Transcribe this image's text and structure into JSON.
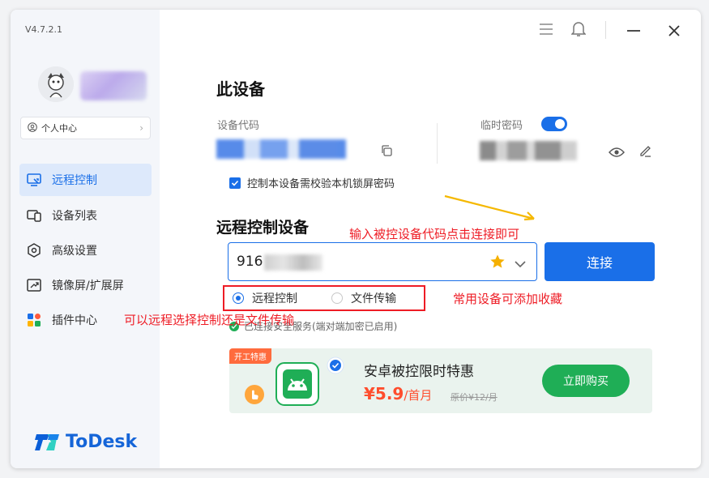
{
  "app": {
    "version": "V4.7.2.1",
    "logo_text": "ToDesk"
  },
  "sidebar": {
    "profile_button": "个人中心",
    "items": [
      {
        "label": "远程控制",
        "icon": "remote-control-icon",
        "active": true
      },
      {
        "label": "设备列表",
        "icon": "device-list-icon",
        "active": false
      },
      {
        "label": "高级设置",
        "icon": "settings-icon",
        "active": false
      },
      {
        "label": "镜像屏/扩展屏",
        "icon": "mirror-screen-icon",
        "active": false
      },
      {
        "label": "插件中心",
        "icon": "plugin-icon",
        "active": false
      }
    ]
  },
  "this_device": {
    "title": "此设备",
    "code_label": "设备代码",
    "temp_password_label": "临时密码",
    "lockscreen_checkbox": "控制本设备需校验本机锁屏密码"
  },
  "remote": {
    "title": "远程控制设备",
    "input_value": "916",
    "connect_button": "连接",
    "mode_remote": "远程控制",
    "mode_file": "文件传输",
    "secure_text": "已连接安全服务(端对端加密已启用)"
  },
  "promo": {
    "tag": "开工特惠",
    "title": "安卓被控限时特惠",
    "price": "¥5.9",
    "period": "/首月",
    "original": "原价¥12/月",
    "buy_button": "立即购买"
  },
  "annotations": {
    "input_hint": "输入被控设备代码点击连接即可",
    "favorite_hint": "常用设备可添加收藏",
    "mode_hint": "可以远程选择控制还是文件传输"
  },
  "colors": {
    "accent": "#1a6fe8",
    "annotation": "#ee1c25",
    "promo_green": "#1fae56"
  }
}
